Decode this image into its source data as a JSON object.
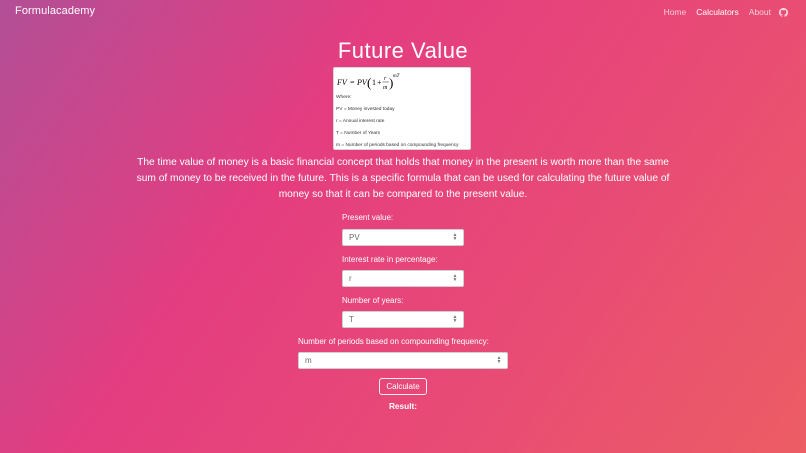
{
  "navbar": {
    "brand": "Formulacademy",
    "links": [
      {
        "label": "Home",
        "active": false
      },
      {
        "label": "Calculators",
        "active": true
      },
      {
        "label": "About",
        "active": false
      }
    ],
    "github_icon": "github-icon"
  },
  "page": {
    "title": "Future Value",
    "intro": "The time value of money is a basic financial concept that holds that money in the present is worth more than the same sum of money to be received in the future. This is a specific formula that can be used for calculating the future value of money so that it can be compared to the present value."
  },
  "formula": {
    "lhs": "FV",
    "eq": "=",
    "pv": "PV",
    "one": "1",
    "plus": "+",
    "r": "r",
    "m": "m",
    "exponent": "mT",
    "where": "Where:",
    "defs": [
      "PV = Money invested today",
      "r = Annual interest rate",
      "T = Number of Years",
      "m = Number of periods based on compounding frequency"
    ]
  },
  "form": {
    "fields": [
      {
        "label": "Present value:",
        "placeholder": "PV"
      },
      {
        "label": "Interest rate in percentage:",
        "placeholder": "r"
      },
      {
        "label": "Number of years:",
        "placeholder": "T"
      },
      {
        "label": "Number of periods based on compounding frequency:",
        "placeholder": "m"
      }
    ],
    "submit_label": "Calculate",
    "result_label": "Result:"
  }
}
